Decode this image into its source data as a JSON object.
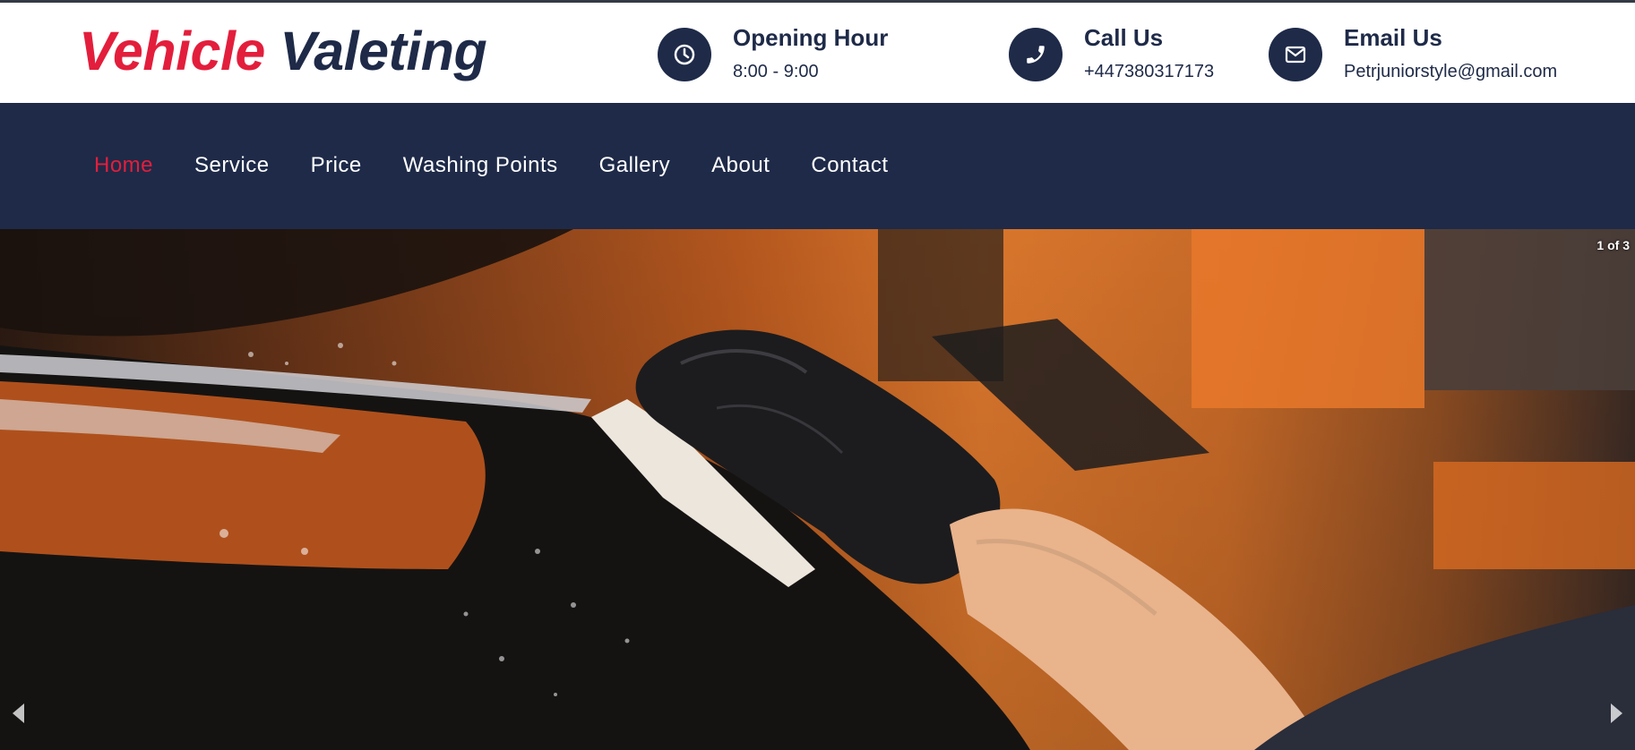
{
  "brand": {
    "word1": "Vehicle",
    "word2": "Valeting"
  },
  "contact": [
    {
      "title": "Opening Hour",
      "value": "8:00 - 9:00",
      "icon": "clock-icon"
    },
    {
      "title": "Call Us",
      "value": "+447380317173",
      "icon": "phone-icon"
    },
    {
      "title": "Email Us",
      "value": "Petrjuniorstyle@gmail.com",
      "icon": "envelope-icon"
    }
  ],
  "nav": {
    "items": [
      "Home",
      "Service",
      "Price",
      "Washing Points",
      "Gallery",
      "About",
      "Contact"
    ],
    "active": "Home"
  },
  "slider": {
    "counter": "1 of 3"
  },
  "colors": {
    "accent": "#e31e3c",
    "navy": "#1e2a48"
  }
}
